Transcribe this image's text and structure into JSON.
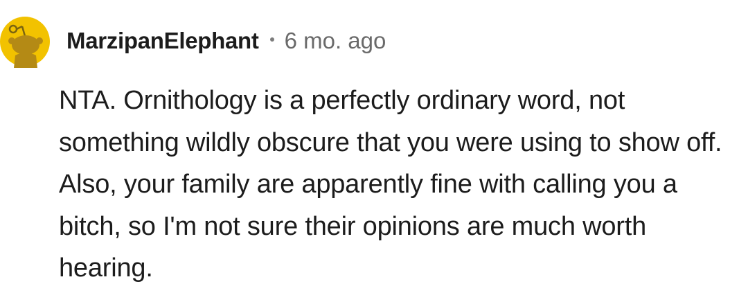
{
  "comment": {
    "author": "MarzipanElephant",
    "separator": "•",
    "timestamp": "6 mo. ago",
    "avatar_icon": "snoo-avatar-icon",
    "avatar_color": "#f2c200",
    "body": "NTA. Ornithology is a perfectly ordinary word, not something wildly obscure that you were using to show off. Also, your family are apparently fine with calling you a bitch, so I'm not sure their opinions are much worth hearing."
  }
}
